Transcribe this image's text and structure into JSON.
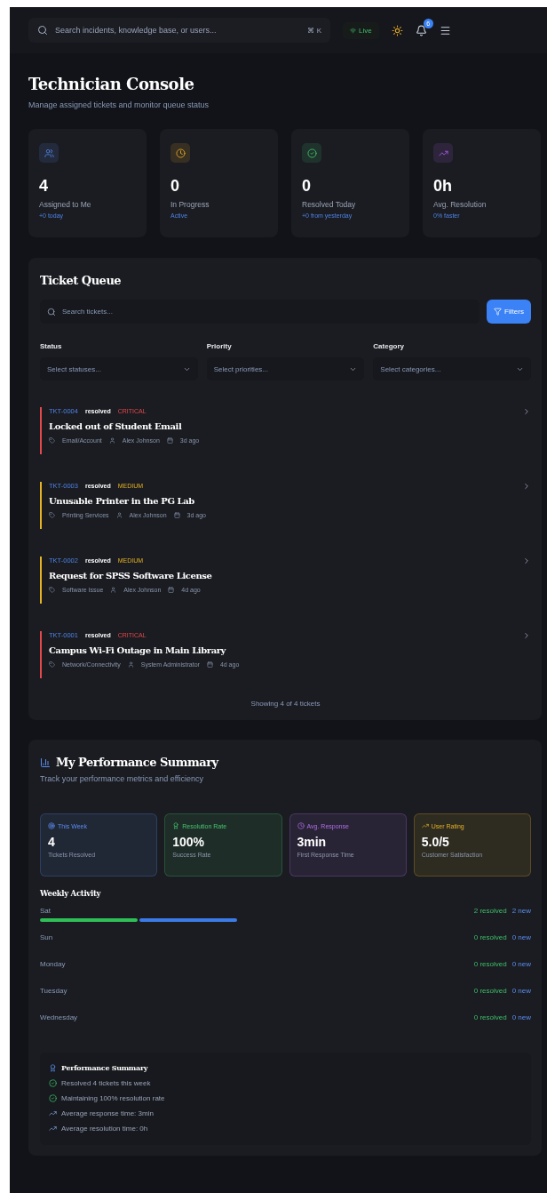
{
  "topbar": {
    "search": {
      "placeholder": "Search incidents, knowledge base, or users...",
      "shortcut": "⌘ K"
    },
    "live": "Live",
    "notifications": "6"
  },
  "header": {
    "title": "Technician Console",
    "subtitle": "Manage assigned tickets and monitor queue status"
  },
  "stats": [
    {
      "kind": "users",
      "value": "4",
      "label": "Assigned to Me",
      "note": "+0 today"
    },
    {
      "kind": "clock",
      "value": "0",
      "label": "In Progress",
      "note": "Active"
    },
    {
      "kind": "check",
      "value": "0",
      "label": "Resolved Today",
      "note": "+0 from yesterday"
    },
    {
      "kind": "trend",
      "value": "0h",
      "label": "Avg. Resolution",
      "note": "0% faster"
    }
  ],
  "queue": {
    "title": "Ticket Queue",
    "search": {
      "placeholder": "Search tickets..."
    },
    "filters_button": "Filters",
    "filters": [
      {
        "label": "Status",
        "placeholder": "Select statuses..."
      },
      {
        "label": "Priority",
        "placeholder": "Select priorities..."
      },
      {
        "label": "Category",
        "placeholder": "Select categories..."
      }
    ],
    "tickets": [
      {
        "id": "TKT-0004",
        "status": "resolved",
        "priority": "CRITICAL",
        "color": "#e5484d",
        "title": "Locked out of Student Email",
        "category": "Email/Account",
        "assignee": "Alex Johnson",
        "age": "3d ago"
      },
      {
        "id": "TKT-0003",
        "status": "resolved",
        "priority": "MEDIUM",
        "color": "#e6b325",
        "title": "Unusable Printer in the PG Lab",
        "category": "Printing Services",
        "assignee": "Alex Johnson",
        "age": "3d ago"
      },
      {
        "id": "TKT-0002",
        "status": "resolved",
        "priority": "MEDIUM",
        "color": "#e6b325",
        "title": "Request for SPSS Software License",
        "category": "Software Issue",
        "assignee": "Alex Johnson",
        "age": "4d ago"
      },
      {
        "id": "TKT-0001",
        "status": "resolved",
        "priority": "CRITICAL",
        "color": "#e5484d",
        "title": "Campus Wi-Fi Outage in Main Library",
        "category": "Network/Connectivity",
        "assignee": "System Administrator",
        "age": "4d ago"
      }
    ],
    "footer": "Showing 4 of 4 tickets"
  },
  "performance": {
    "title": "My Performance Summary",
    "subtitle": "Track your performance metrics and efficiency",
    "metrics": [
      {
        "kind": "target",
        "label": "This Week",
        "value": "4",
        "caption": "Tickets Resolved"
      },
      {
        "kind": "award",
        "label": "Resolution Rate",
        "value": "100%",
        "caption": "Success Rate"
      },
      {
        "kind": "clock",
        "label": "Avg. Response",
        "value": "3min",
        "caption": "First Response Time"
      },
      {
        "kind": "trend",
        "label": "User Rating",
        "value": "5.0/5",
        "caption": "Customer Satisfaction"
      }
    ],
    "weekly_title": "Weekly Activity",
    "days": [
      {
        "day": "Sat",
        "resolved": "2 resolved",
        "new": "2 new",
        "bars": [
          {
            "kind": "resolved"
          },
          {
            "kind": "new"
          }
        ]
      },
      {
        "day": "Sun",
        "resolved": "0 resolved",
        "new": "0 new"
      },
      {
        "day": "Monday",
        "resolved": "0 resolved",
        "new": "0 new"
      },
      {
        "day": "Tuesday",
        "resolved": "0 resolved",
        "new": "0 new"
      },
      {
        "day": "Wednesday",
        "resolved": "0 resolved",
        "new": "0 new"
      }
    ],
    "summary": {
      "title": "Performance Summary",
      "items": [
        {
          "kind": "check",
          "text": "Resolved 4 tickets this week"
        },
        {
          "kind": "check",
          "text": "Maintaining 100% resolution rate"
        },
        {
          "kind": "trend",
          "text": "Average response time: 3min"
        },
        {
          "kind": "trend",
          "text": "Average resolution time: 0h"
        }
      ]
    }
  }
}
